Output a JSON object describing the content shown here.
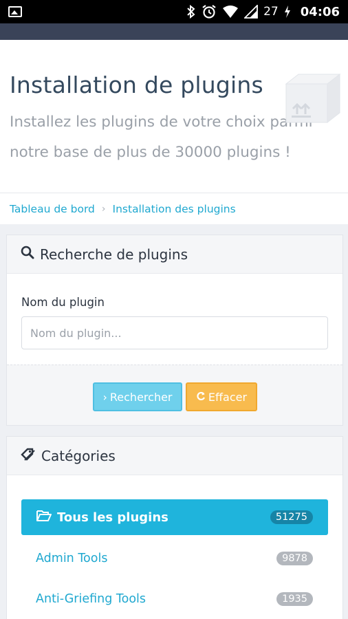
{
  "status_bar": {
    "battery": "27",
    "time": "04:06",
    "icons": [
      "gallery-icon",
      "bluetooth-icon",
      "alarm-icon",
      "wifi-icon",
      "signal-icon",
      "battery-charging-icon"
    ]
  },
  "header": {
    "title": "Installation de plugins",
    "subtitle": "Installez les plugins de votre choix parmi notre base de plus de 30000 plugins !",
    "icon": "box-icon"
  },
  "breadcrumb": {
    "items": [
      "Tableau de bord",
      "Installation des plugins"
    ]
  },
  "search_panel": {
    "title": "Recherche de plugins",
    "field_label": "Nom du plugin",
    "field_placeholder": "Nom du plugin...",
    "field_value": "",
    "search_button": "Rechercher",
    "clear_button": "Effacer"
  },
  "categories_panel": {
    "title": "Catégories",
    "items": [
      {
        "label": "Tous les plugins",
        "count": "51275",
        "active": true
      },
      {
        "label": "Admin Tools",
        "count": "9878",
        "active": false
      },
      {
        "label": "Anti-Griefing Tools",
        "count": "1935",
        "active": false
      }
    ]
  },
  "colors": {
    "accent": "#1fb4dc",
    "link": "#1fa8d0",
    "warning": "#f8bb4e",
    "appbar": "#3a4358"
  }
}
